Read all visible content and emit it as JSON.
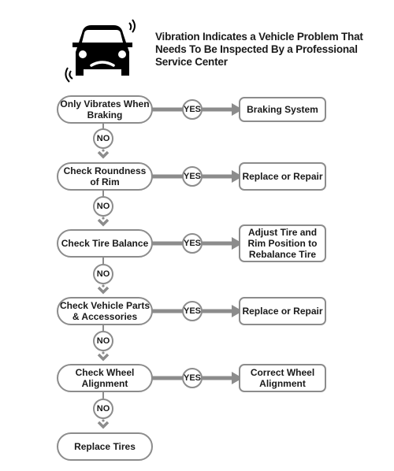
{
  "header": {
    "icon": "vibrating-car-icon",
    "title": "Vibration Indicates a Vehicle Problem That Needs To Be Inspected By a Professional Service Center"
  },
  "labels": {
    "yes": "YES",
    "no": "NO"
  },
  "colors": {
    "connector": "#8c8c8c",
    "text": "#1a1a1a",
    "icon": "#000000"
  },
  "steps": [
    {
      "check": "Only Vibrates When Braking",
      "result": "Braking System"
    },
    {
      "check": "Check Roundness of Rim",
      "result": "Replace or Repair"
    },
    {
      "check": "Check Tire Balance",
      "result": "Adjust Tire and Rim Position to Rebalance Tire"
    },
    {
      "check": "Check Vehicle Parts & Accessories",
      "result": "Replace or Repair"
    },
    {
      "check": "Check Wheel Alignment",
      "result": "Correct Wheel Alignment"
    }
  ],
  "final": "Replace Tires"
}
